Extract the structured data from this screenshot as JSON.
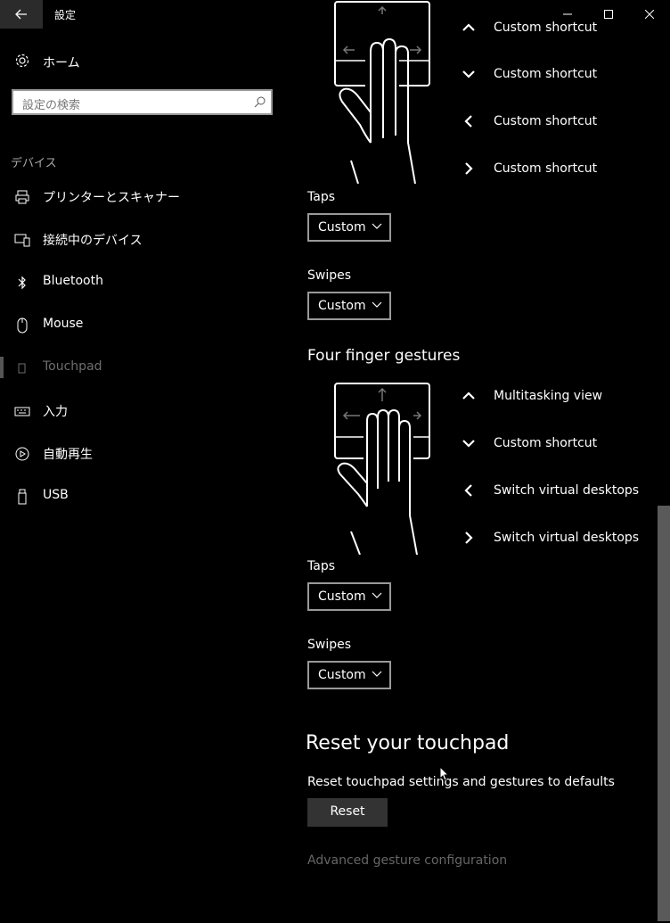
{
  "window": {
    "title": "設定"
  },
  "sidebar": {
    "home_label": "ホーム",
    "search_placeholder": "設定の検索",
    "section_heading": "デバイス",
    "items": [
      {
        "label": "プリンターとスキャナー",
        "icon": "printer-icon"
      },
      {
        "label": "接続中のデバイス",
        "icon": "connected-devices-icon"
      },
      {
        "label": "Bluetooth",
        "icon": "bluetooth-icon"
      },
      {
        "label": "Mouse",
        "icon": "mouse-icon"
      },
      {
        "label": "Touchpad",
        "icon": "touchpad-icon",
        "active": true
      },
      {
        "label": "入力",
        "icon": "keyboard-icon"
      },
      {
        "label": "自動再生",
        "icon": "autoplay-icon"
      },
      {
        "label": "USB",
        "icon": "usb-icon"
      }
    ]
  },
  "three_finger": {
    "gestures": [
      {
        "dir": "up",
        "label": "Custom shortcut"
      },
      {
        "dir": "down",
        "label": "Custom shortcut"
      },
      {
        "dir": "left",
        "label": "Custom shortcut"
      },
      {
        "dir": "right",
        "label": "Custom shortcut"
      }
    ],
    "taps_label": "Taps",
    "taps_value": "Custom",
    "swipes_label": "Swipes",
    "swipes_value": "Custom"
  },
  "four_finger": {
    "heading": "Four finger gestures",
    "gestures": [
      {
        "dir": "up",
        "label": "Multitasking view"
      },
      {
        "dir": "down",
        "label": "Custom shortcut"
      },
      {
        "dir": "left",
        "label": "Switch virtual desktops"
      },
      {
        "dir": "right",
        "label": "Switch virtual desktops"
      }
    ],
    "taps_label": "Taps",
    "taps_value": "Custom",
    "swipes_label": "Swipes",
    "swipes_value": "Custom"
  },
  "reset": {
    "heading": "Reset your touchpad",
    "description": "Reset touchpad settings and gestures to defaults",
    "button": "Reset"
  },
  "advanced_link": "Advanced gesture configuration",
  "colors": {
    "background": "#000000",
    "accent_gray": "#333333",
    "muted": "#666666"
  }
}
